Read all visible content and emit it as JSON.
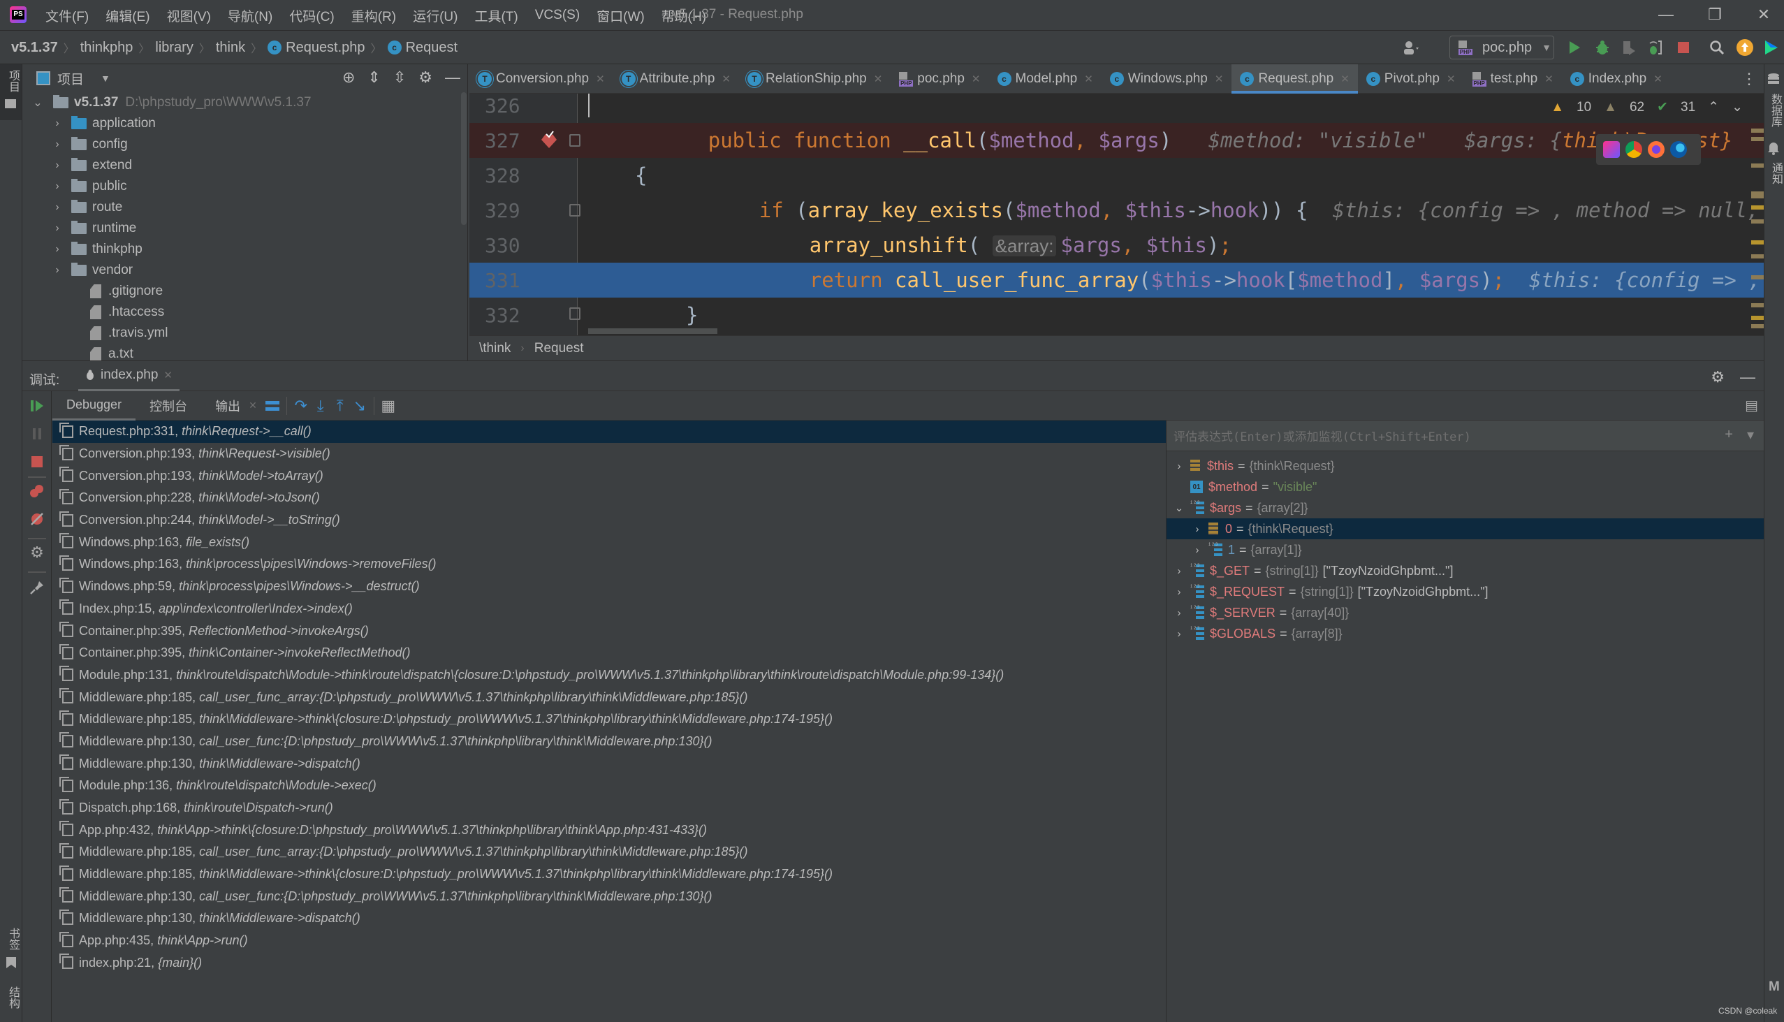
{
  "menubar": {
    "app_logo": "PS",
    "items": [
      "文件(F)",
      "编辑(E)",
      "视图(V)",
      "导航(N)",
      "代码(C)",
      "重构(R)",
      "运行(U)",
      "工具(T)",
      "VCS(S)",
      "窗口(W)",
      "帮助(H)"
    ],
    "window_title": "v5.1.37 - Request.php",
    "minimize": "—",
    "restore": "❐",
    "close": "✕"
  },
  "navbar": {
    "breadcrumbs": [
      "v5.1.37",
      "thinkphp",
      "library",
      "think",
      "Request.php",
      "Request"
    ],
    "class_icon_letter": "c",
    "run_config": "poc.php",
    "run_config_icon": "PHP"
  },
  "leftstrip": {
    "project_label": "项目",
    "bookmarks_label": "书签",
    "structure_label": "结构"
  },
  "rightstrip": {
    "database_label": "数据库",
    "notifications_label": "通知",
    "maven_label": "M"
  },
  "project": {
    "title": "项目",
    "root": {
      "name": "v5.1.37",
      "path": "D:\\phpstudy_pro\\WWW\\v5.1.37"
    },
    "folders": [
      {
        "name": "application",
        "blue": true
      },
      {
        "name": "config"
      },
      {
        "name": "extend"
      },
      {
        "name": "public"
      },
      {
        "name": "route"
      },
      {
        "name": "runtime"
      },
      {
        "name": "thinkphp"
      },
      {
        "name": "vendor"
      }
    ],
    "files": [
      ".gitignore",
      ".htaccess",
      ".travis.yml",
      "a.txt"
    ]
  },
  "tabs": [
    {
      "label": "Conversion.php",
      "icon": "trait"
    },
    {
      "label": "Attribute.php",
      "icon": "trait"
    },
    {
      "label": "RelationShip.php",
      "icon": "trait"
    },
    {
      "label": "poc.php",
      "icon": "php"
    },
    {
      "label": "Model.php",
      "icon": "class"
    },
    {
      "label": "Windows.php",
      "icon": "class"
    },
    {
      "label": "Request.php",
      "icon": "class",
      "active": true
    },
    {
      "label": "Pivot.php",
      "icon": "class"
    },
    {
      "label": "test.php",
      "icon": "php"
    },
    {
      "label": "Index.php",
      "icon": "class"
    }
  ],
  "inspections": {
    "warnings": "10",
    "weak_warnings": "62",
    "typos": "31"
  },
  "code": {
    "lines": [
      {
        "num": "326"
      },
      {
        "num": "327",
        "public": "public",
        "function": "function",
        "name": "__call",
        "p1": "$method",
        "p2": "$args",
        "hint1": "$method: \"visible\"",
        "hint2a": "$args: {",
        "hint2b": "think\\Request}"
      },
      {
        "num": "328",
        "text": "{"
      },
      {
        "num": "329",
        "kw": "if",
        "fn": "array_key_exists",
        "v1": "$method",
        "v2": "$this",
        "prop": "hook",
        "hint": "$this: {config => , method => null, hook..."
      },
      {
        "num": "330",
        "fn": "array_unshift",
        "inlay": "&array:",
        "v1": "$args",
        "v2": "$this"
      },
      {
        "num": "331",
        "kw": "return",
        "fn": "call_user_func_array",
        "v1": "$this",
        "prop": "hook",
        "v2": "$method",
        "v3": "$args",
        "hint": "$this: {config => , me..."
      },
      {
        "num": "332",
        "text": "}"
      }
    ]
  },
  "editor_breadcrumb": [
    "\\think",
    "Request"
  ],
  "debug": {
    "label": "调试:",
    "session": "index.php",
    "tabs": [
      "Debugger",
      "控制台",
      "输出"
    ]
  },
  "frames": [
    {
      "loc": "Request.php:331,",
      "fn": "think\\Request->__call()"
    },
    {
      "loc": "Conversion.php:193,",
      "fn": "think\\Request->visible()"
    },
    {
      "loc": "Conversion.php:193,",
      "fn": "think\\Model->toArray()"
    },
    {
      "loc": "Conversion.php:228,",
      "fn": "think\\Model->toJson()"
    },
    {
      "loc": "Conversion.php:244,",
      "fn": "think\\Model->__toString()"
    },
    {
      "loc": "Windows.php:163,",
      "fn": "file_exists()"
    },
    {
      "loc": "Windows.php:163,",
      "fn": "think\\process\\pipes\\Windows->removeFiles()"
    },
    {
      "loc": "Windows.php:59,",
      "fn": "think\\process\\pipes\\Windows->__destruct()"
    },
    {
      "loc": "Index.php:15,",
      "fn": "app\\index\\controller\\Index->index()"
    },
    {
      "loc": "Container.php:395,",
      "fn": "ReflectionMethod->invokeArgs()"
    },
    {
      "loc": "Container.php:395,",
      "fn": "think\\Container->invokeReflectMethod()"
    },
    {
      "loc": "Module.php:131,",
      "fn": "think\\route\\dispatch\\Module->think\\route\\dispatch\\{closure:D:\\phpstudy_pro\\WWW\\v5.1.37\\thinkphp\\library\\think\\route\\dispatch\\Module.php:99-134}()"
    },
    {
      "loc": "Middleware.php:185,",
      "fn": "call_user_func_array:{D:\\phpstudy_pro\\WWW\\v5.1.37\\thinkphp\\library\\think\\Middleware.php:185}()"
    },
    {
      "loc": "Middleware.php:185,",
      "fn": "think\\Middleware->think\\{closure:D:\\phpstudy_pro\\WWW\\v5.1.37\\thinkphp\\library\\think\\Middleware.php:174-195}()"
    },
    {
      "loc": "Middleware.php:130,",
      "fn": "call_user_func:{D:\\phpstudy_pro\\WWW\\v5.1.37\\thinkphp\\library\\think\\Middleware.php:130}()"
    },
    {
      "loc": "Middleware.php:130,",
      "fn": "think\\Middleware->dispatch()"
    },
    {
      "loc": "Module.php:136,",
      "fn": "think\\route\\dispatch\\Module->exec()"
    },
    {
      "loc": "Dispatch.php:168,",
      "fn": "think\\route\\Dispatch->run()"
    },
    {
      "loc": "App.php:432,",
      "fn": "think\\App->think\\{closure:D:\\phpstudy_pro\\WWW\\v5.1.37\\thinkphp\\library\\think\\App.php:431-433}()"
    },
    {
      "loc": "Middleware.php:185,",
      "fn": "call_user_func_array:{D:\\phpstudy_pro\\WWW\\v5.1.37\\thinkphp\\library\\think\\Middleware.php:185}()"
    },
    {
      "loc": "Middleware.php:185,",
      "fn": "think\\Middleware->think\\{closure:D:\\phpstudy_pro\\WWW\\v5.1.37\\thinkphp\\library\\think\\Middleware.php:174-195}()"
    },
    {
      "loc": "Middleware.php:130,",
      "fn": "call_user_func:{D:\\phpstudy_pro\\WWW\\v5.1.37\\thinkphp\\library\\think\\Middleware.php:130}()"
    },
    {
      "loc": "Middleware.php:130,",
      "fn": "think\\Middleware->dispatch()"
    },
    {
      "loc": "App.php:435,",
      "fn": "think\\App->run()"
    },
    {
      "loc": "index.php:21,",
      "fn": "{main}()"
    }
  ],
  "variables": {
    "eval_placeholder": "评估表达式(Enter)或添加监视(Ctrl+Shift+Enter)",
    "items": [
      {
        "name": "$this",
        "value": "{think\\Request}",
        "type": "object",
        "expand": "collapsed",
        "indent": 0
      },
      {
        "name": "$method",
        "value": "\"visible\"",
        "type": "string",
        "expand": "none",
        "indent": 0
      },
      {
        "name": "$args",
        "value": "{array[2]}",
        "type": "array",
        "expand": "expanded",
        "indent": 0
      },
      {
        "name": "0",
        "value": "{think\\Request}",
        "type": "object",
        "expand": "collapsed",
        "indent": 1,
        "selected": true
      },
      {
        "name": "1",
        "value": "{array[1]}",
        "type": "array",
        "expand": "collapsed",
        "indent": 1,
        "numeric": true
      },
      {
        "name": "$_GET",
        "value": "{string[1]}",
        "extra": "[\"TzoyNzoidGhpbmt...\"]",
        "type": "array",
        "expand": "collapsed",
        "indent": 0
      },
      {
        "name": "$_REQUEST",
        "value": "{string[1]}",
        "extra": "[\"TzoyNzoidGhpbmt...\"]",
        "type": "array",
        "expand": "collapsed",
        "indent": 0
      },
      {
        "name": "$_SERVER",
        "value": "{array[40]}",
        "type": "array",
        "expand": "collapsed",
        "indent": 0
      },
      {
        "name": "$GLOBALS",
        "value": "{array[8]}",
        "type": "array",
        "expand": "collapsed",
        "indent": 0
      }
    ]
  },
  "watermark": "CSDN @coleak",
  "colors": {
    "exec_line": "#2d5c94",
    "breakpoint_line": "#3a2323",
    "active_tab_underline": "#4a88c7",
    "selection": "#0d293e"
  }
}
